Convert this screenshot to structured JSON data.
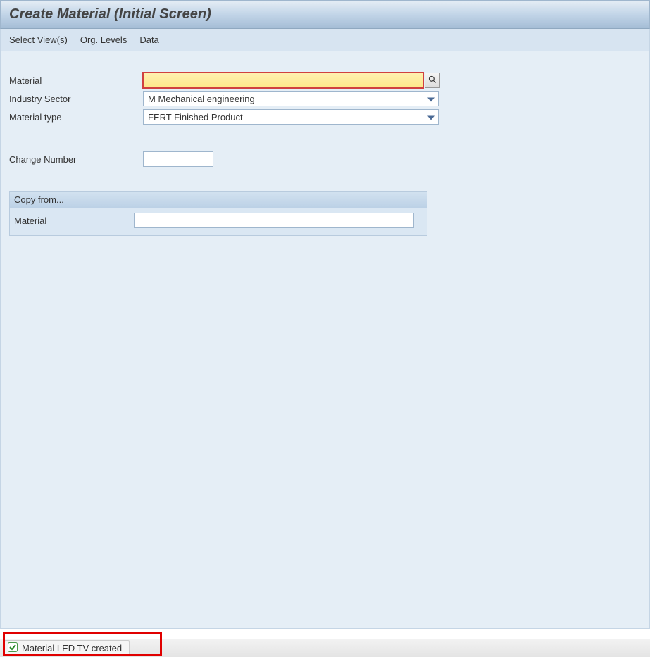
{
  "title": "Create Material (Initial Screen)",
  "menu": {
    "select_views": "Select View(s)",
    "org_levels": "Org. Levels",
    "data": "Data"
  },
  "form": {
    "material_label": "Material",
    "material_value": "",
    "industry_sector_label": "Industry Sector",
    "industry_sector_value": "M Mechanical engineering",
    "material_type_label": "Material type",
    "material_type_value": "FERT Finished Product",
    "change_number_label": "Change Number",
    "change_number_value": ""
  },
  "copy_from": {
    "header": "Copy from...",
    "material_label": "Material",
    "material_value": ""
  },
  "status": {
    "message": "Material LED TV created"
  }
}
